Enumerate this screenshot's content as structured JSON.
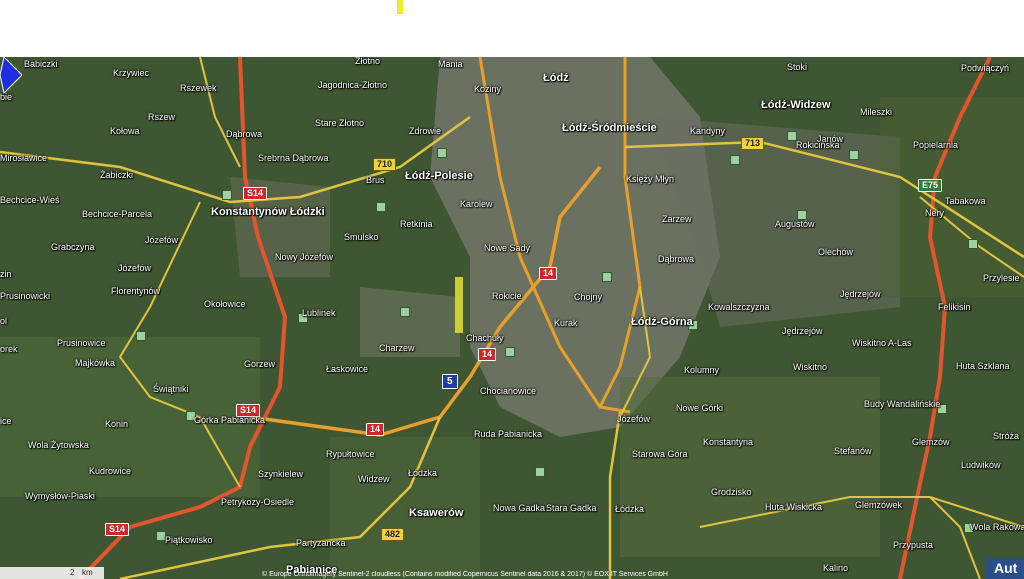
{
  "labels": {
    "babiczki": "Babiczki",
    "krzywiec": "Krzywiec",
    "zlotno": "Złotno",
    "mania": "Mania",
    "lodz": "Łódź",
    "stoki": "Stoki",
    "podwiaczyn": "Podwiączyń",
    "rszewek": "Rszewek",
    "jagodnica": "Jagodnica-Złotno",
    "koziny": "Koziny",
    "lodz_widzew": "Łódź-Widzew",
    "mileszki": "Mileszki",
    "kolowa": "Kołowa",
    "rszew": "Rszew",
    "dabrowa1": "Dąbrowa",
    "stare_zlotno": "Stare Złotno",
    "zdrowie": "Zdrowie",
    "srodmiescie": "Łódź-Śródmieście",
    "janow": "Janów",
    "popielarnia": "Popielarnia",
    "miroslawice": "Mirosławice",
    "zabiczki": "Żabiczki",
    "srebrna": "Srebrna Dąbrowa",
    "brus": "Brus",
    "polesie": "Łódź-Polesie",
    "ksiezy_mlyn": "Księży Młyn",
    "rokicinska": "Rokicińska",
    "nery": "Nery",
    "bechcice_wies": "Bechcice-Wieś",
    "konstantynow": "Konstantynów Łódzki",
    "karolew": "Karolew",
    "bechcice_parcela": "Bechcice-Parcela",
    "smulsko": "Smulsko",
    "retkinia": "Retkinia",
    "zarzew": "Zarzew",
    "augustow": "Augustów",
    "grabczyna": "Grabczyna",
    "jozefow1": "Józefów",
    "nowy_jozefow": "Nowy Józefów",
    "nowe_sady": "Nowe Sady",
    "olechow": "Olechów",
    "dabrowa2": "Dąbrowa",
    "przylesie": "Przylesie",
    "jozefow2": "Józefów",
    "rokicie": "Rokicie",
    "chojny": "Chojny",
    "jedrzejow_str": "Jędrzejów",
    "florentynow": "Florentynów",
    "lublinek": "Lublinek",
    "kowalszczyzna": "Kowalszczyzna",
    "felikisin": "Felikisin",
    "okolowice": "Okołowice",
    "kurak": "Kurak",
    "lodz_gorna": "Łódź-Górna",
    "rusinowicki": "Prusinowicki",
    "chachuly": "Chachuły",
    "jedrzejow": "Jędrzejów",
    "orek": "orek",
    "prusinowice": "Prusinowice",
    "charzew": "Charzew",
    "wiskitno_alas": "Wiskitno A-Las",
    "huta_szklana": "Huta Szklana",
    "majkowka": "Majkówka",
    "gorzew": "Gorzew",
    "laskowice": "Łaskowice",
    "kolumny": "Kolumny",
    "wiskitno": "Wiskitno",
    "swiatniki": "Świątniki",
    "chocianowice": "Chocianowice",
    "budy": "Budy Wandalińskie",
    "konin": "Konin",
    "gorka": "Górka Pabianicka",
    "jozefow3": "Józefów",
    "nowe_gorki": "Nowe Górki",
    "stroza": "Stróża",
    "ruda": "Ruda Pabianicka",
    "konstantyna": "Konstantyna",
    "glemzow": "Glemzów",
    "wola_zytowska": "Wola Żytowska",
    "rypultowice": "Rypułtowice",
    "stefanow": "Stefanów",
    "kudrowice": "Kudrowice",
    "szynkielew": "Szynkielew",
    "starowa": "Starowa Góra",
    "ludwikow": "Ludwików",
    "widzew": "Widzew",
    "wymyslow": "Wymysłów-Piaski",
    "petrykozy": "Petrykozy-Osiedle",
    "grodzisko": "Grodzisko",
    "ksawerow": "Ksawerów",
    "glemzowek": "Glemzówek",
    "lodzka": "Łódzka",
    "huta_wiskicka": "Huta Wiskicka",
    "nowa_gadka": "Nowa Gadka",
    "stara_gadka": "Stara Gadka",
    "piatkowisko": "Piątkowisko",
    "partyzancka": "Partyzancka",
    "przypusta": "Przypusta",
    "wola_rakowa": "Wola Rakowa",
    "kalino": "Kalino",
    "pabianice": "Pabianice",
    "zin": "zin",
    "bie": "bie",
    "ice": "ice",
    "ol": "ol",
    "lodzka_str": "Łódzka",
    "kandyny": "Kandyny",
    "tabaka": "Tabakowa"
  },
  "shields": {
    "s14_a": "S14",
    "s14_b": "S14",
    "s14_c": "S14",
    "r14_a": "14",
    "r14_b": "14",
    "r14_c": "14",
    "y710": "710",
    "y713": "713",
    "y482": "482",
    "e75": "E75",
    "b5": "5"
  },
  "scale": {
    "value": "2",
    "unit": "km"
  },
  "attribution": "© Europe Orthoimagery Sentinel-2 cloudless (Contains modified Copernicus Sentinel data 2016 & 2017) © EOX IT Services GmbH",
  "auto_button": "Aut",
  "colors": {
    "road_orange": "#e8a02a",
    "road_yellow": "#e0c441",
    "expressway": "#e3552e",
    "route_blue": "#1d2fe0"
  }
}
